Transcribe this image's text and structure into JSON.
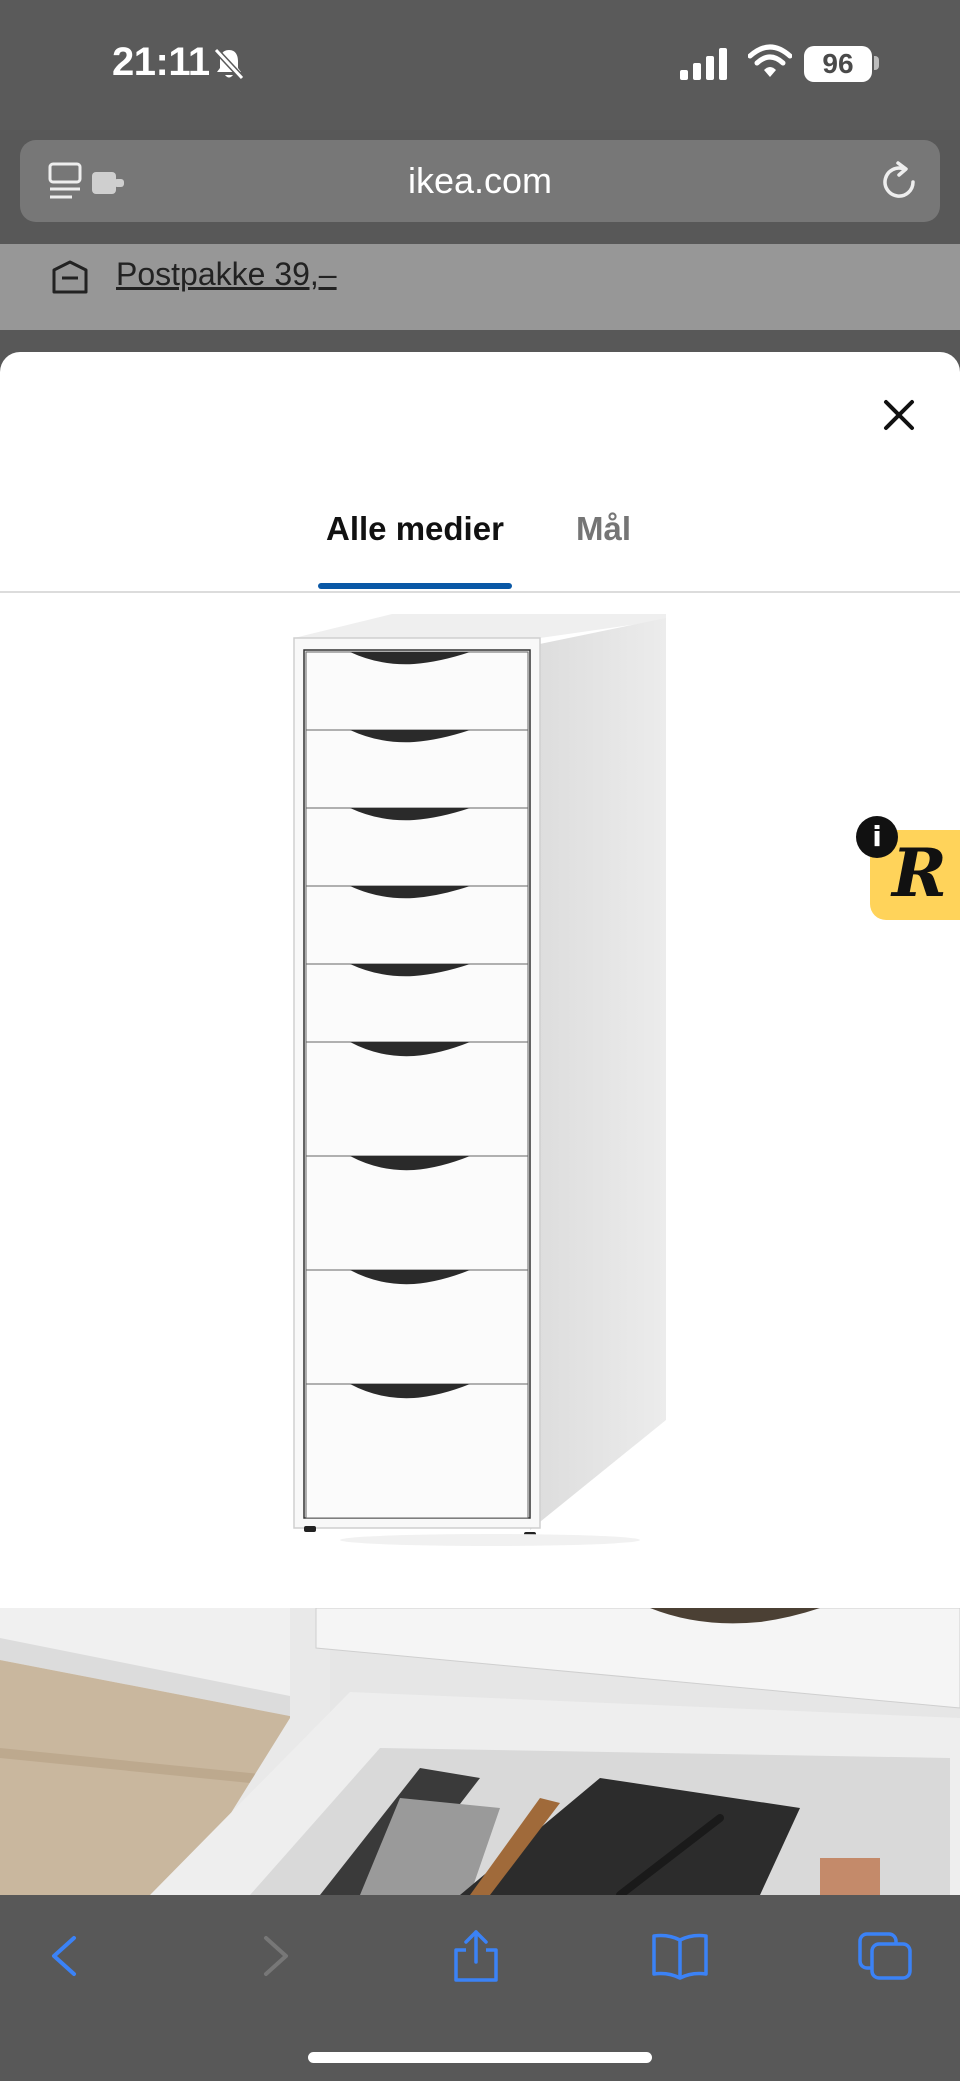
{
  "status_bar": {
    "time": "21:11",
    "battery": "96"
  },
  "browser": {
    "url": "ikea.com"
  },
  "promo": {
    "text": "Postpakke 39,–"
  },
  "media_modal": {
    "tabs": [
      {
        "label": "Alle medier",
        "active": true
      },
      {
        "label": "Mål",
        "active": false
      }
    ]
  },
  "extension_badge": {
    "letter": "R",
    "info": "i"
  },
  "colors": {
    "accent": "#0a58a6",
    "badge": "#ffd35a",
    "ios_blue": "#3b82f6"
  },
  "toolbar": {
    "icons": [
      "back-icon",
      "forward-icon",
      "share-icon",
      "bookmarks-icon",
      "tabs-icon"
    ]
  }
}
